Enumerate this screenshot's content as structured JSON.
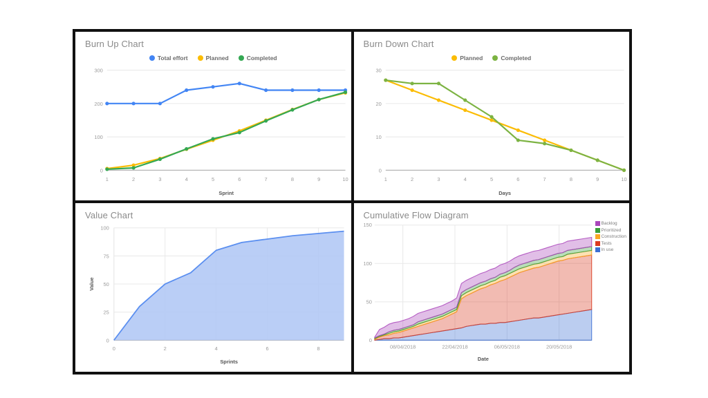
{
  "colors": {
    "blue": "#4285F4",
    "yellow": "#FBBC04",
    "green": "#34A853",
    "area_blue_line": "#5B8FF0",
    "area_blue_fill": "#AEC6F5",
    "backlog": "#AA46BB",
    "prioritized": "#39A039",
    "construction": "#F9A825",
    "tests": "#DB3B21",
    "in_use": "#3B6FD4",
    "panel_border": "#111111",
    "title_grey": "#8a8a8a"
  },
  "panels": {
    "burn_up": {
      "title": "Burn Up Chart"
    },
    "burn_down": {
      "title": "Burn Down Chart"
    },
    "value": {
      "title": "Value Chart"
    },
    "cfd": {
      "title": "Cumulative Flow Diagram"
    }
  },
  "chart_data": [
    {
      "id": "burn_up",
      "type": "line",
      "title": "Burn Up Chart",
      "xlabel": "Sprint",
      "ylabel": "",
      "x": [
        1,
        2,
        3,
        4,
        5,
        6,
        7,
        8,
        9,
        10
      ],
      "xticks": [
        "1",
        "2",
        "3",
        "4",
        "5",
        "6",
        "7",
        "8",
        "9",
        "10"
      ],
      "yticks": [
        "0",
        "100",
        "200",
        "300"
      ],
      "ylim": [
        0,
        300
      ],
      "xlim": [
        1,
        10
      ],
      "grid": true,
      "legend": "top-center",
      "series": [
        {
          "name": "Total effort",
          "color": "#4285F4",
          "values": [
            200,
            200,
            200,
            240,
            250,
            260,
            240,
            240,
            240,
            240
          ]
        },
        {
          "name": "Planned",
          "color": "#FBBC04",
          "values": [
            5,
            15,
            35,
            63,
            90,
            118,
            150,
            182,
            212,
            232
          ]
        },
        {
          "name": "Completed",
          "color": "#34A853",
          "values": [
            3,
            7,
            33,
            64,
            94,
            113,
            148,
            181,
            212,
            234
          ]
        }
      ]
    },
    {
      "id": "burn_down",
      "type": "line",
      "title": "Burn Down Chart",
      "xlabel": "Days",
      "ylabel": "",
      "x": [
        1,
        2,
        3,
        4,
        5,
        6,
        7,
        8,
        9,
        10
      ],
      "xticks": [
        "1",
        "2",
        "3",
        "4",
        "5",
        "6",
        "7",
        "8",
        "9",
        "10"
      ],
      "yticks": [
        "0",
        "10",
        "20",
        "30"
      ],
      "ylim": [
        0,
        30
      ],
      "xlim": [
        1,
        10
      ],
      "grid": true,
      "legend": "top-center",
      "series": [
        {
          "name": "Planned",
          "color": "#FBBC04",
          "values": [
            27,
            24,
            21,
            18,
            15,
            12,
            9,
            6,
            3,
            0
          ]
        },
        {
          "name": "Completed",
          "color": "#7CB342",
          "values": [
            27,
            26,
            26,
            21,
            16,
            9,
            8,
            6,
            3,
            0
          ]
        }
      ]
    },
    {
      "id": "value",
      "type": "area",
      "title": "Value Chart",
      "xlabel": "Sprints",
      "ylabel": "Value",
      "x": [
        0,
        1,
        2,
        3,
        4,
        5,
        6,
        7,
        8,
        9
      ],
      "xticks": [
        "0",
        "2",
        "4",
        "6",
        "8"
      ],
      "yticks": [
        "0",
        "25",
        "50",
        "75",
        "100"
      ],
      "ylim": [
        0,
        100
      ],
      "xlim": [
        0,
        9
      ],
      "grid": true,
      "legend": "none",
      "series": [
        {
          "name": "Value",
          "color": "#5B8FF0",
          "fill": "#AEC6F5",
          "values": [
            0,
            30,
            50,
            60,
            80,
            87,
            90,
            93,
            95,
            97
          ]
        }
      ]
    },
    {
      "id": "cfd",
      "type": "area",
      "title": "Cumulative Flow Diagram",
      "xlabel": "Date",
      "ylabel": "",
      "xticks": [
        "08/04/2018",
        "22/04/2018",
        "06/05/2018",
        "20/05/2018"
      ],
      "yticks": [
        "0",
        "50",
        "100",
        "150"
      ],
      "ylim": [
        0,
        150
      ],
      "grid": true,
      "legend": "right",
      "stacked": true,
      "x": [
        0,
        1,
        2,
        3,
        4,
        5,
        6,
        7,
        8,
        9,
        10,
        11,
        12,
        13,
        14,
        15,
        16,
        17,
        18,
        19,
        20,
        21,
        22,
        23,
        24,
        25,
        26,
        27,
        28,
        29,
        30,
        31,
        32,
        33,
        34,
        35,
        36,
        37,
        38,
        39,
        40,
        41,
        42,
        43,
        44,
        45
      ],
      "series": [
        {
          "name": "In use",
          "color": "#3B6FD4",
          "values": [
            0,
            1,
            2,
            2,
            3,
            3,
            4,
            5,
            6,
            7,
            8,
            9,
            10,
            11,
            12,
            13,
            14,
            15,
            16,
            18,
            19,
            20,
            21,
            21,
            22,
            22,
            23,
            23,
            24,
            25,
            26,
            27,
            28,
            29,
            29,
            30,
            31,
            32,
            33,
            34,
            35,
            36,
            37,
            38,
            39,
            40
          ]
        },
        {
          "name": "Tests",
          "color": "#DB3B21",
          "values": [
            1,
            3,
            4,
            5,
            6,
            7,
            8,
            9,
            10,
            11,
            12,
            13,
            14,
            15,
            16,
            18,
            20,
            22,
            38,
            40,
            42,
            44,
            46,
            48,
            50,
            52,
            54,
            56,
            58,
            60,
            62,
            63,
            64,
            65,
            66,
            67,
            68,
            69,
            70,
            70,
            71,
            71,
            71,
            71,
            71,
            71
          ]
        },
        {
          "name": "Construction",
          "color": "#F9A825",
          "values": [
            1,
            1,
            1,
            2,
            2,
            2,
            2,
            2,
            2,
            3,
            3,
            3,
            3,
            3,
            3,
            3,
            3,
            3,
            4,
            4,
            4,
            4,
            4,
            4,
            4,
            4,
            5,
            5,
            5,
            5,
            5,
            5,
            5,
            5,
            5,
            5,
            5,
            5,
            5,
            5,
            6,
            6,
            6,
            6,
            6,
            6
          ]
        },
        {
          "name": "Prioritized",
          "color": "#39A039",
          "values": [
            1,
            1,
            1,
            2,
            2,
            2,
            2,
            2,
            2,
            3,
            3,
            3,
            3,
            3,
            3,
            3,
            3,
            3,
            4,
            4,
            4,
            4,
            4,
            4,
            4,
            4,
            4,
            4,
            4,
            5,
            5,
            5,
            5,
            5,
            5,
            5,
            5,
            5,
            5,
            5,
            5,
            5,
            5,
            5,
            5,
            5
          ]
        },
        {
          "name": "Backlog",
          "color": "#AA46BB",
          "values": [
            1,
            8,
            9,
            10,
            10,
            10,
            10,
            10,
            11,
            11,
            11,
            11,
            11,
            11,
            11,
            11,
            11,
            12,
            12,
            12,
            12,
            12,
            12,
            12,
            12,
            12,
            12,
            12,
            12,
            12,
            12,
            12,
            12,
            12,
            12,
            12,
            12,
            12,
            12,
            12,
            12,
            12,
            12,
            12,
            12,
            12
          ]
        }
      ]
    }
  ]
}
